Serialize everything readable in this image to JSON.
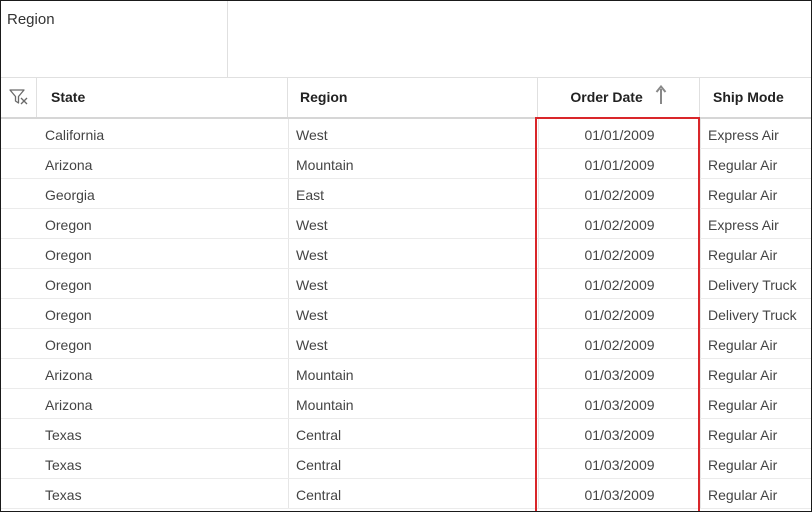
{
  "group_panel": {
    "grouped_field": "Region"
  },
  "columns": {
    "state": "State",
    "region": "Region",
    "order_date": "Order Date",
    "ship_mode": "Ship Mode"
  },
  "icons": {
    "filter": "filter-icon",
    "sort": "sort-ascending-arrow-icon"
  },
  "colors": {
    "highlight": "#d9262a"
  },
  "rows": [
    {
      "state": "California",
      "region": "West",
      "order_date": "01/01/2009",
      "ship_mode": "Express Air"
    },
    {
      "state": "Arizona",
      "region": "Mountain",
      "order_date": "01/01/2009",
      "ship_mode": "Regular Air"
    },
    {
      "state": "Georgia",
      "region": "East",
      "order_date": "01/02/2009",
      "ship_mode": "Regular Air"
    },
    {
      "state": "Oregon",
      "region": "West",
      "order_date": "01/02/2009",
      "ship_mode": "Express Air"
    },
    {
      "state": "Oregon",
      "region": "West",
      "order_date": "01/02/2009",
      "ship_mode": "Regular Air"
    },
    {
      "state": "Oregon",
      "region": "West",
      "order_date": "01/02/2009",
      "ship_mode": "Delivery Truck"
    },
    {
      "state": "Oregon",
      "region": "West",
      "order_date": "01/02/2009",
      "ship_mode": "Delivery Truck"
    },
    {
      "state": "Oregon",
      "region": "West",
      "order_date": "01/02/2009",
      "ship_mode": "Regular Air"
    },
    {
      "state": "Arizona",
      "region": "Mountain",
      "order_date": "01/03/2009",
      "ship_mode": "Regular Air"
    },
    {
      "state": "Arizona",
      "region": "Mountain",
      "order_date": "01/03/2009",
      "ship_mode": "Regular Air"
    },
    {
      "state": "Texas",
      "region": "Central",
      "order_date": "01/03/2009",
      "ship_mode": "Regular Air"
    },
    {
      "state": "Texas",
      "region": "Central",
      "order_date": "01/03/2009",
      "ship_mode": "Regular Air"
    },
    {
      "state": "Texas",
      "region": "Central",
      "order_date": "01/03/2009",
      "ship_mode": "Regular Air"
    }
  ]
}
